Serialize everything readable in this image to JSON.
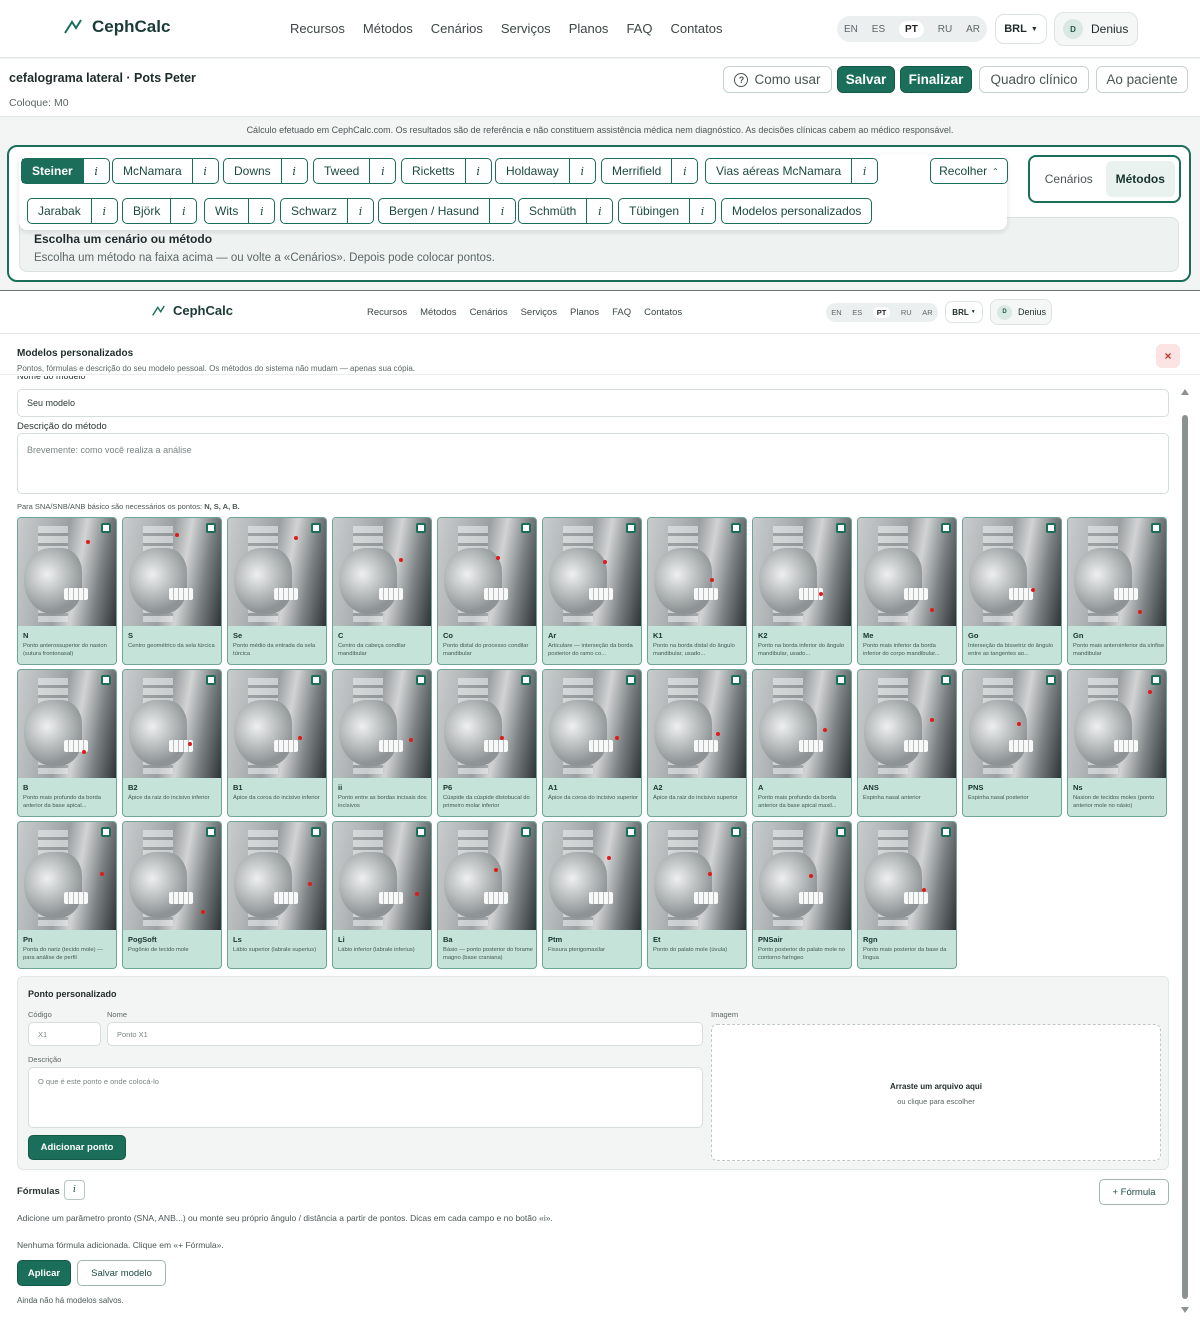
{
  "brand": "CephCalc",
  "nav": [
    "Recursos",
    "Métodos",
    "Cenários",
    "Serviços",
    "Planos",
    "FAQ",
    "Contatos"
  ],
  "languages": [
    "EN",
    "ES",
    "PT",
    "RU",
    "AR"
  ],
  "active_language": "PT",
  "currency": "BRL",
  "user": {
    "initial": "D",
    "name": "Denius"
  },
  "header": {
    "title": "cefalograma lateral · Pots Peter",
    "subtitle": "Coloque: M0",
    "how_to": "Como usar",
    "save": "Salvar",
    "finish": "Finalizar",
    "clinical": "Quadro clínico",
    "patient": "Ao paciente"
  },
  "disclaimer": "Cálculo efetuado em CephCalc.com. Os resultados são de referência e não constituem assistência médica nem diagnóstico. As decisões clínicas cabem ao médico responsável.",
  "methods_row1": [
    "Steiner",
    "McNamara",
    "Downs",
    "Tweed",
    "Ricketts",
    "Holdaway",
    "Merrifield",
    "Vias aéreas McNamara"
  ],
  "methods_row2": [
    "Jarabak",
    "Björk",
    "Wits",
    "Schwarz",
    "Bergen / Hasund",
    "Schmüth",
    "Tübingen"
  ],
  "custom_models_chip": "Modelos personalizados",
  "info_glyph": "i",
  "collapse": "Recolher",
  "mode_tabs": [
    "Cenários",
    "Métodos"
  ],
  "choose": {
    "title": "Escolha um cenário ou método",
    "text": "Escolha um método na faixa acima — ou volte a «Cenários». Depois pode colocar pontos."
  },
  "modal": {
    "title": "Modelos personalizados",
    "subtitle": "Pontos, fórmulas e descrição do seu modelo pessoal. Os métodos do sistema não mudam — apenas sua cópia.",
    "close": "×",
    "name_label": "Nome do modelo",
    "name_value": "Seu modelo",
    "desc_label": "Descrição do método",
    "desc_placeholder": "Brevemente: como você realiza a análise",
    "hint_prefix": "Para SNA/SNB/ANB básico são necessários os pontos:",
    "hint_points": "N, S, A, B."
  },
  "points": [
    {
      "code": "N",
      "desc": "Ponto anterossuperior do nasion (sutura frontonasal)"
    },
    {
      "code": "S",
      "desc": "Centro geométrico da sela túrcica"
    },
    {
      "code": "Se",
      "desc": "Ponto médio da entrada da sela túrcica"
    },
    {
      "code": "C",
      "desc": "Centro da cabeça condilar mandibular"
    },
    {
      "code": "Co",
      "desc": "Ponto distal do processo condilar mandibular"
    },
    {
      "code": "Ar",
      "desc": "Articulare — interseção da borda posterior do ramo co..."
    },
    {
      "code": "K1",
      "desc": "Ponto na borda distal do ângulo mandibular, usado..."
    },
    {
      "code": "K2",
      "desc": "Ponto na borda inferior do ângulo mandibular, usado..."
    },
    {
      "code": "Me",
      "desc": "Ponto mais inferior da borda inferior do corpo mandibular..."
    },
    {
      "code": "Go",
      "desc": "Interseção da bissetriz do ângulo entre as tangentes ao..."
    },
    {
      "code": "Gn",
      "desc": "Ponto mais anteroinferior da sínfise mandibular"
    },
    {
      "code": "B",
      "desc": "Ponto mais profundo da borda anterior da base apical..."
    },
    {
      "code": "B2",
      "desc": "Ápice da raiz do incisivo inferior"
    },
    {
      "code": "B1",
      "desc": "Ápice da coroa do incisivo inferior"
    },
    {
      "code": "ii",
      "desc": "Ponto entre as bordas incisais dos incisivos"
    },
    {
      "code": "P6",
      "desc": "Cúspide da cúspide distobucal do primeiro molar inferior"
    },
    {
      "code": "A1",
      "desc": "Ápice da coroa do incisivo superior"
    },
    {
      "code": "A2",
      "desc": "Ápice da raiz do incisivo superior"
    },
    {
      "code": "A",
      "desc": "Ponto mais profundo da borda anterior da base apical maxil..."
    },
    {
      "code": "ANS",
      "desc": "Espinha nasal anterior"
    },
    {
      "code": "PNS",
      "desc": "Espinha nasal posterior"
    },
    {
      "code": "Ns",
      "desc": "Nasion de tecidos moles (ponto anterior mole no násio)"
    },
    {
      "code": "Pn",
      "desc": "Ponta do nariz (tecido mole) — para análise de perfil"
    },
    {
      "code": "PogSoft",
      "desc": "Pogônio de tecido mole"
    },
    {
      "code": "Ls",
      "desc": "Lábio superior (labrale superius)"
    },
    {
      "code": "Li",
      "desc": "Lábio inferior (labrale inferius)"
    },
    {
      "code": "Ba",
      "desc": "Básio — ponto posterior do forame magno (base craniana)"
    },
    {
      "code": "Ptm",
      "desc": "Fissura pterigomaxilar"
    },
    {
      "code": "Et",
      "desc": "Ponto do palato mole (úvula)"
    },
    {
      "code": "PNSair",
      "desc": "Ponto posterior do palato mole no contorno faríngeo"
    },
    {
      "code": "Rgn",
      "desc": "Ponto mais posterior da base da língua"
    }
  ],
  "custom_point": {
    "title": "Ponto personalizado",
    "code_label": "Código",
    "code_placeholder": "X1",
    "name_label": "Nome",
    "name_placeholder": "Ponto X1",
    "desc_label": "Descrição",
    "desc_placeholder": "O que é este ponto e onde colocá-lo",
    "image_label": "Imagem",
    "drop_title": "Arraste um arquivo aqui",
    "drop_sub": "ou clique para escolher",
    "add_button": "Adicionar ponto"
  },
  "formulas": {
    "title": "Fórmulas",
    "add": "+ Fórmula",
    "help": "Adicione um parâmetro pronto (SNA, ANB...) ou monte seu próprio ângulo / distância a partir de pontos. Dicas em cada campo e no botão «i».",
    "empty": "Nenhuma fórmula adicionada. Clique em «+ Fórmula».",
    "apply": "Aplicar",
    "save_model": "Salvar modelo",
    "no_models": "Ainda não há modelos salvos."
  },
  "colors": {
    "accent": "#1b6f5a",
    "card": "#c6e3da",
    "landmark": "#e01b1b"
  }
}
